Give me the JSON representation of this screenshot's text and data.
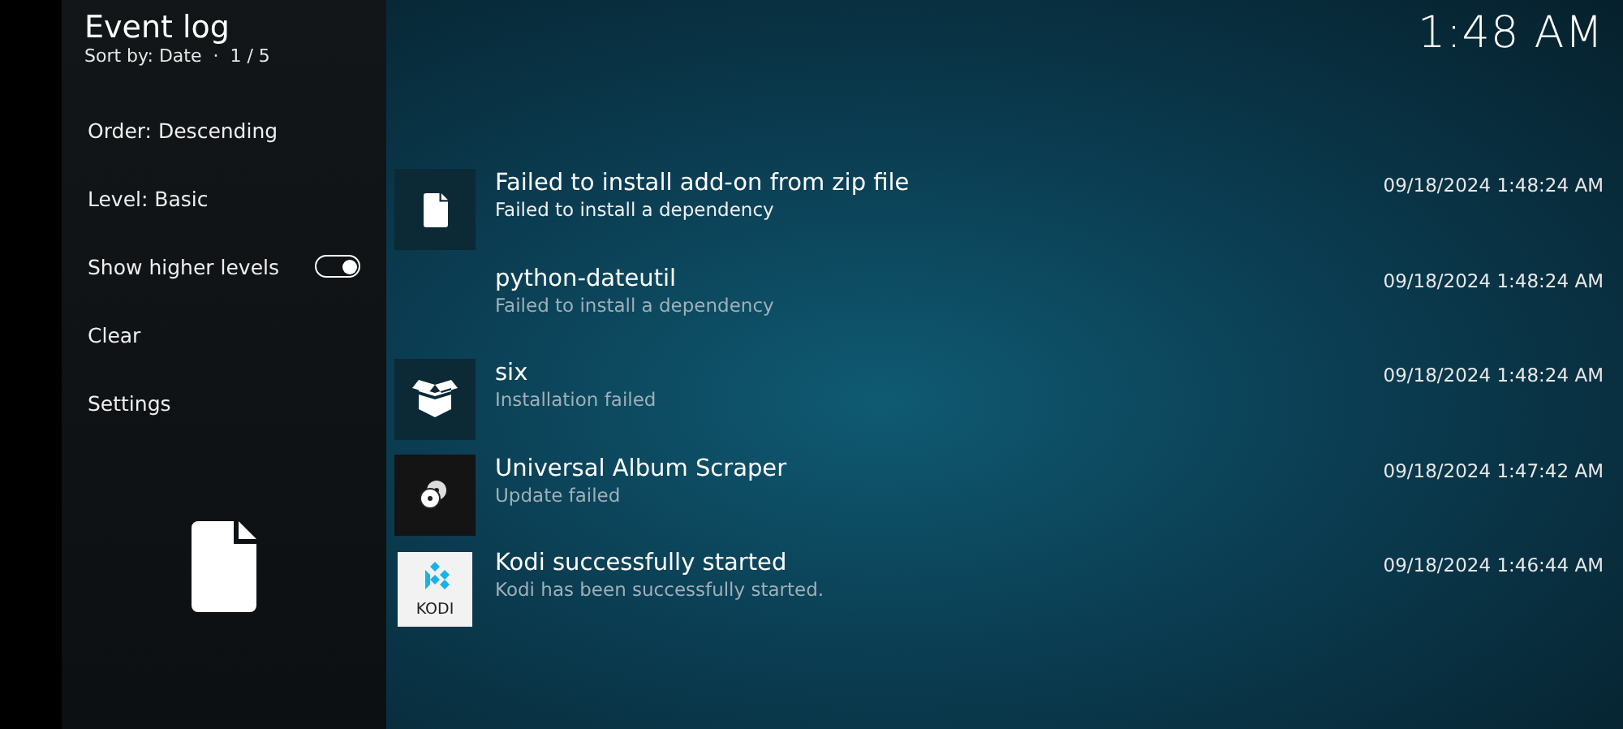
{
  "header": {
    "title": "Event log",
    "subtitle": "Sort by: Date  ·  1 / 5"
  },
  "clock": "1:48 AM",
  "sidebar": {
    "items": [
      {
        "kind": "option",
        "label": "Order: Descending"
      },
      {
        "kind": "option",
        "label": "Level: Basic"
      },
      {
        "kind": "toggle",
        "label": "Show higher levels",
        "on": true
      },
      {
        "kind": "option",
        "label": "Clear"
      },
      {
        "kind": "option",
        "label": "Settings"
      }
    ]
  },
  "events": [
    {
      "kind": "file",
      "title": "Failed to install add-on from zip file",
      "message": "Failed to install a dependency",
      "time": "09/18/2024 1:48:24 AM",
      "selected": true
    },
    {
      "kind": "plain",
      "title": "python-dateutil",
      "message": "Failed to install a dependency",
      "time": "09/18/2024 1:48:24 AM",
      "selected": false
    },
    {
      "kind": "package",
      "title": "six",
      "message": "Installation failed",
      "time": "09/18/2024 1:48:24 AM",
      "selected": false
    },
    {
      "kind": "addon",
      "title": "Universal Album Scraper",
      "message": "Update failed",
      "time": "09/18/2024 1:47:42 AM",
      "selected": false
    },
    {
      "kind": "app",
      "logo_text": "KODI",
      "title": "Kodi successfully started",
      "message": "Kodi has been successfully started.",
      "time": "09/18/2024 1:46:44 AM",
      "selected": false
    }
  ]
}
